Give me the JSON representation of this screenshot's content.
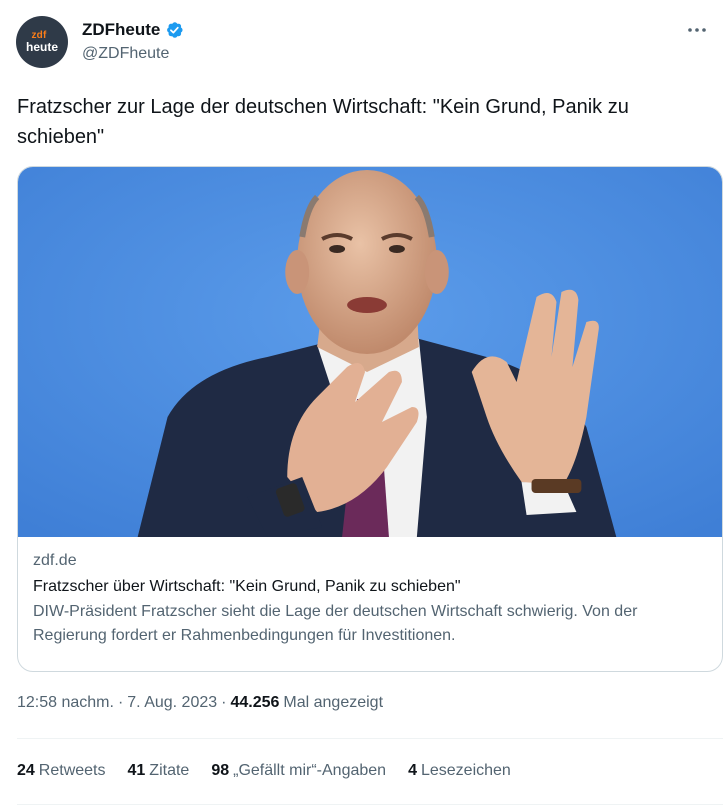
{
  "author": {
    "display_name": "ZDFheute",
    "handle": "@ZDFheute",
    "avatar_text_top": "zdf",
    "avatar_text_bottom": "heute",
    "avatar_bg": "#2f3a48",
    "avatar_accent": "#fa7d19",
    "verified_icon": "verified-badge-icon",
    "verified_color": "#1d9bf0"
  },
  "menu_icon": "more-options-icon",
  "tweet": {
    "text": "Fratzscher zur Lage der deutschen Wirtschaft: \"Kein Grund, Panik zu schieben\""
  },
  "card": {
    "domain": "zdf.de",
    "title": "Fratzscher über Wirtschaft: \"Kein Grund, Panik zu schieben\"",
    "description": "DIW-Präsident Fratzscher sieht die Lage der deutschen Wirtschaft schwierig. Von der Regierung fordert er Rahmenbedingungen für Investitionen.",
    "image_subject": "man-in-suit-gesturing-photo"
  },
  "meta": {
    "time": "12:58 nachm.",
    "date": "7. Aug. 2023",
    "separator": "·",
    "views_count": "44.256",
    "views_label": "Mal angezeigt"
  },
  "stats": [
    {
      "count": "24",
      "label": "Retweets"
    },
    {
      "count": "41",
      "label": "Zitate"
    },
    {
      "count": "98",
      "label": "„Gefällt mir“-Angaben"
    },
    {
      "count": "4",
      "label": "Lesezeichen"
    }
  ],
  "colors": {
    "text_primary": "#0f1419",
    "text_secondary": "#536471",
    "border": "#cfd9de",
    "photo_background": "#4d8fe0"
  }
}
